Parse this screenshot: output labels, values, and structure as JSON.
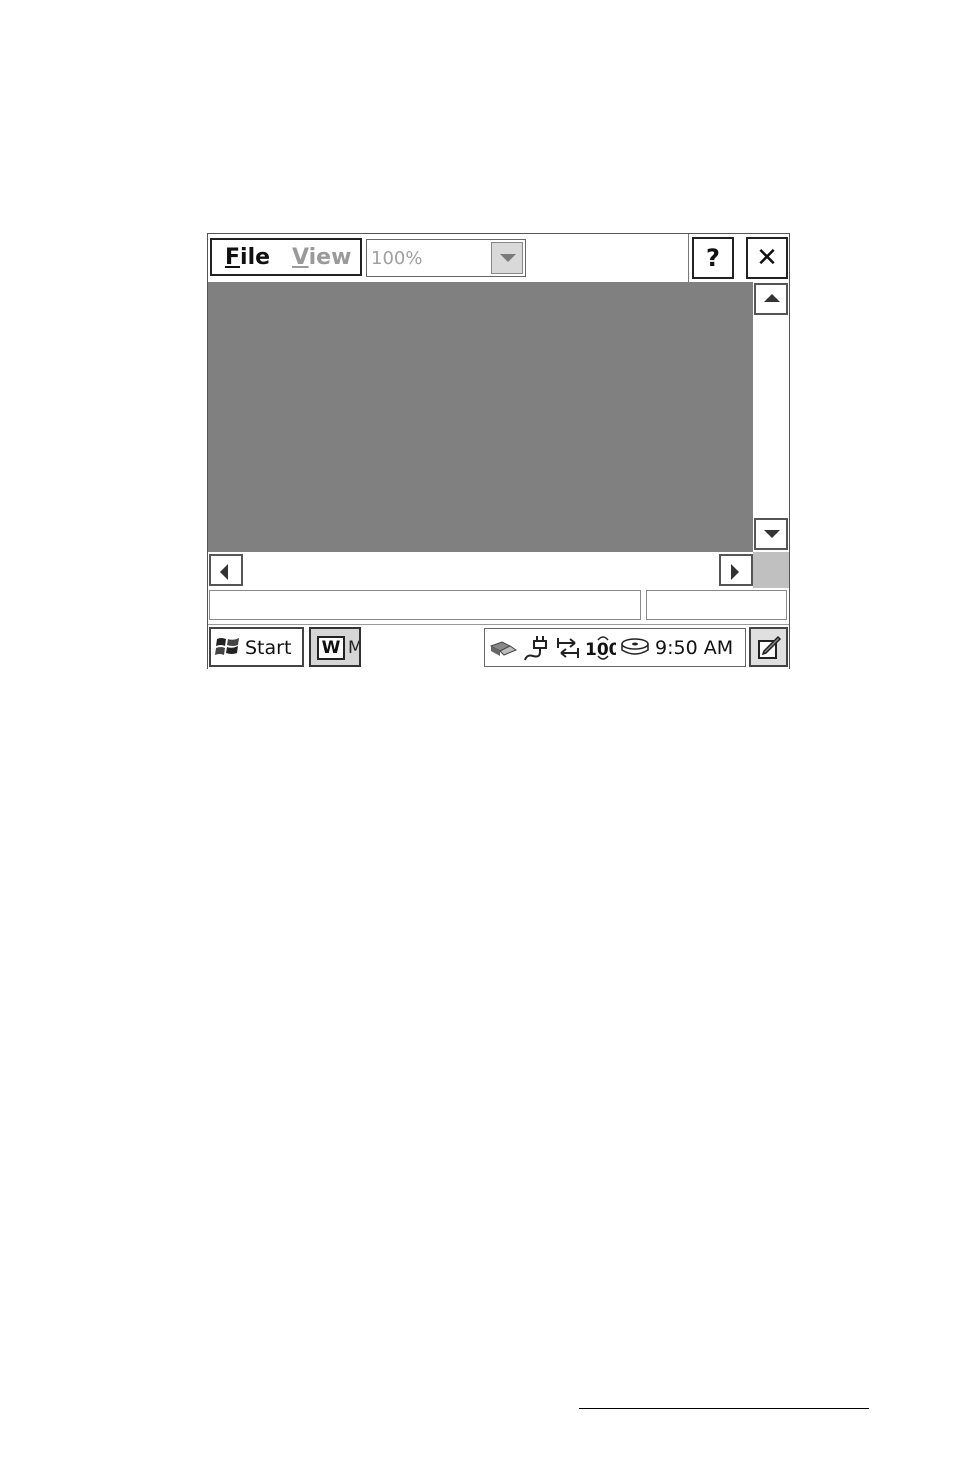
{
  "menu": {
    "file_label": "File",
    "file_mnemonic": "F",
    "file_rest": "ile",
    "view_label": "View",
    "view_mnemonic": "V",
    "view_rest": "iew"
  },
  "zoom": {
    "value": "100%"
  },
  "toolbar": {
    "help_label": "?",
    "close_label": "✕"
  },
  "taskbar": {
    "start_label": "Start",
    "task_icon_label": "W",
    "task_label": "M",
    "time": "9:50 AM",
    "tray_icons": [
      "network-icon",
      "power-plug-icon",
      "sync-arrows-icon",
      "ethernet-100-icon",
      "disk-icon"
    ]
  },
  "colors": {
    "client_area": "#808080",
    "disabled_text": "#9a9a9a",
    "size_grip": "#c0c0c0"
  }
}
